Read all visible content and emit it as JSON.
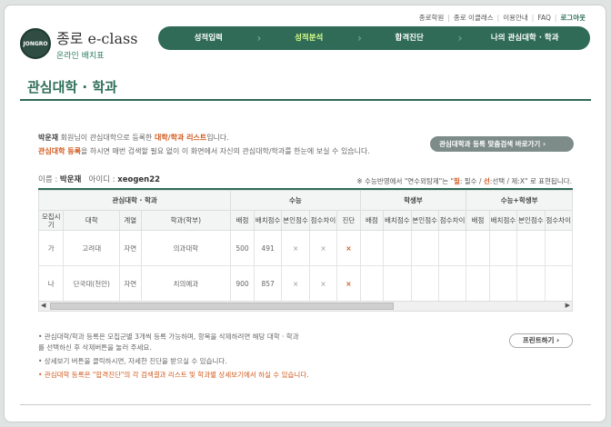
{
  "toplinks": [
    "종로학원",
    "종로 이클래스",
    "이용안내",
    "FAQ",
    "로그아웃"
  ],
  "logo": {
    "emblem": "JONGRO",
    "main": "종로 e-class",
    "sub": "온라인 배치표"
  },
  "nav": [
    {
      "label": "성적입력",
      "active": false
    },
    {
      "label": "성적분석",
      "active": true
    },
    {
      "label": "합격진단",
      "active": false
    },
    {
      "label": "나의 관심대학 · 학과",
      "active": false
    }
  ],
  "page_title": "관심대학 · 학과",
  "intro": {
    "user": "박운재",
    "line1_a": "회원님이 관심대학으로 등록한",
    "line1_b": "대학/학과 리스트",
    "line1_c": "입니다.",
    "line2_a": "관심대학 등록",
    "line2_b": "을 하시면 매번 검색할 필요 없이 이 화면에서 자신의 관심대학/학과를 한눈에 보실 수 있습니다."
  },
  "my_search_button": "관심대학과 등록 맞춤검색 바로가기",
  "user_info": {
    "name_label": "이름 :",
    "name": "박운재",
    "id_label": "아이디 :",
    "id": "xeogen22"
  },
  "legend": {
    "prefix": "※ 수능반영에서 \"연수외탐제\"는 \"",
    "p": "필",
    "mid1": ": 필수 / ",
    "s": "선",
    "mid2": ":선택 / 제:X\" 로 표현됩니다."
  },
  "table": {
    "group_headers": [
      "관심대학 · 학과",
      "수능",
      "학생부",
      "수능+학생부"
    ],
    "sub_headers": [
      "모집시기",
      "대학",
      "계열",
      "학과(학부)",
      "배점",
      "배치점수",
      "본인점수",
      "점수차이",
      "진단",
      "배점",
      "배치점수",
      "본인점수",
      "점수차이",
      "배점",
      "배치점수",
      "본인점수",
      "점수차이"
    ],
    "rows": [
      {
        "cells": [
          "가",
          "고려대",
          "자연",
          "의과대학",
          "500",
          "491",
          "×",
          "×",
          "×",
          "",
          "",
          "",
          "",
          "",
          "",
          "",
          ""
        ]
      },
      {
        "cells": [
          "나",
          "단국대(천안)",
          "자연",
          "치의예과",
          "900",
          "857",
          "×",
          "×",
          "×",
          "",
          "",
          "",
          "",
          "",
          "",
          "",
          ""
        ]
      }
    ]
  },
  "notes": [
    "• 관심대학/학과 등록은 모집군별 3개씩 등록 가능하며, 항목을 삭제하려면 해당 대학 · 학과를 선택하신 후 삭제버튼을 눌러 주세요.",
    "• 상세보기 버튼을 클릭하시면, 자세한 진단을 받으실 수 있습니다.",
    "• 관심대학 등록은 \"합격진단\"의 각 검색결과 리스트 및 학과별 상세보기에서 하실 수 있습니다."
  ],
  "print_button": "프린트하기"
}
